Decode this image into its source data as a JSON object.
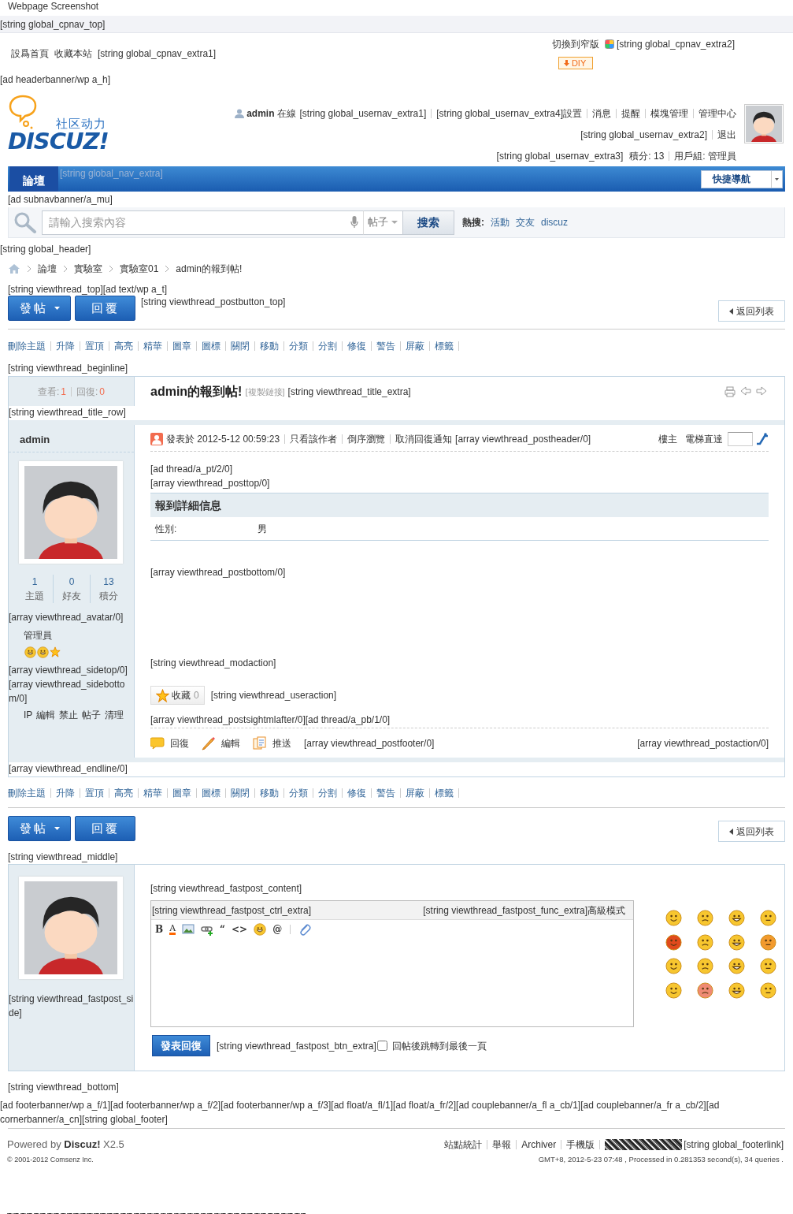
{
  "page_title": "Webpage Screenshot",
  "cpnav": {
    "top_text": "[string global_cpnav_top]",
    "links": [
      "設爲首頁",
      "收藏本站"
    ],
    "extra1": "[string global_cpnav_extra1]",
    "switch_width": "切換到窄版",
    "extra2": "[string global_cpnav_extra2]",
    "diy": "DIY"
  },
  "header_ad": "[ad headerbanner/wp a_h]",
  "logo": {
    "tagline": "社区动力",
    "wordmark": "DISCUZ!"
  },
  "usernav": {
    "username": "admin",
    "status": "在線",
    "extra1": "[string global_usernav_extra1]",
    "links": [
      "[string global_usernav_extra4]設置",
      "消息",
      "提醒",
      "模塊管理",
      "管理中心"
    ],
    "extra2": "[string global_usernav_extra2]",
    "logout": "退出",
    "extra3": "[string global_usernav_extra3]",
    "credits": "積分: 13",
    "group": "用戶組: 管理員"
  },
  "nav": {
    "items": [
      {
        "label": "論壇",
        "selected": true
      }
    ],
    "extra": "[string global_nav_extra]",
    "quick_nav": "快捷導航"
  },
  "subnav_ad": "[ad subnavbanner/a_mu]",
  "search": {
    "placeholder": "請輸入搜索內容",
    "scope": "帖子",
    "button": "搜索",
    "hot_label": "熱搜:",
    "hot": [
      "活動",
      "交友",
      "discuz"
    ]
  },
  "global_header": "[string global_header]",
  "breadcrumb": [
    "論壇",
    "實驗室",
    "實驗室01",
    "admin的報到帖!"
  ],
  "viewthread_top": "[string viewthread_top][ad text/wp a_t]",
  "post_bar_top": {
    "post": "發帖",
    "reply": "回覆",
    "extra": "[string viewthread_postbutton_top]",
    "back": "返回列表"
  },
  "mod_links_top": [
    "刪除主題",
    "升降",
    "置頂",
    "高亮",
    "精華",
    "圖章",
    "圖標",
    "關閉",
    "移動",
    "分類",
    "分割",
    "修復",
    "警告",
    "屏蔽",
    "標籤"
  ],
  "beginline": "[string viewthread_beginline]",
  "thread": {
    "views_label": "查看:",
    "views": "1",
    "replies_label": "回復:",
    "replies": "0",
    "title": "admin的報到帖!",
    "copy_link": "[複製鏈接]",
    "title_extra": "[string viewthread_title_extra]",
    "title_row": "[string viewthread_title_row]"
  },
  "post": {
    "author": "admin",
    "stats": [
      {
        "value": "1",
        "label": "主題"
      },
      {
        "value": "0",
        "label": "好友"
      },
      {
        "value": "13",
        "label": "積分"
      }
    ],
    "avatar_extra": "[array viewthread_avatar/0]",
    "group": "管理員",
    "side_extra": "[array viewthread_sidetop/0][array viewthread_sidebottom/0]",
    "admin_links": [
      "IP",
      "編輯",
      "禁止",
      "帖子",
      "清理"
    ],
    "posted": "發表於 2012-5-12 00:59:23",
    "header_links": [
      "只看該作者",
      "倒序瀏覽",
      "取消回復通知"
    ],
    "header_extra": "[array viewthread_postheader/0]",
    "floor": "樓主",
    "jump": "電梯直達",
    "ad_pt": "[ad thread/a_pt/2/0]",
    "posttop": "[array viewthread_posttop/0]",
    "info_title": "報到詳細信息",
    "fields": [
      {
        "label": "性別:",
        "value": "男"
      }
    ],
    "postbottom": "[array viewthread_postbottom/0]",
    "modaction": "[string viewthread_modaction]",
    "favorite": {
      "label": "收藏",
      "count": "0"
    },
    "useraction": "[string viewthread_useraction]",
    "sightml": "[array viewthread_postsightmlafter/0][ad thread/a_pb/1/0]",
    "actions": [
      {
        "kind": "reply",
        "label": "回復"
      },
      {
        "kind": "edit",
        "label": "編輯"
      },
      {
        "kind": "push",
        "label": "推送"
      }
    ],
    "postfooter": "[array viewthread_postfooter/0]",
    "postaction": "[array viewthread_postaction/0]"
  },
  "endline": "[array viewthread_endline/0]",
  "mod_links_bottom": [
    "刪除主題",
    "升降",
    "置頂",
    "高亮",
    "精華",
    "圖章",
    "圖標",
    "關閉",
    "移動",
    "分類",
    "分割",
    "修復",
    "警告",
    "屏蔽",
    "標籤"
  ],
  "post_bar_bottom": {
    "post": "發帖",
    "reply": "回覆",
    "back": "返回列表"
  },
  "middle": "[string viewthread_middle]",
  "fastpost": {
    "side": "[string viewthread_fastpost_side]",
    "content": "[string viewthread_fastpost_content]",
    "ctrl_extra": "[string viewthread_fastpost_ctrl_extra]",
    "func_extra": "[string viewthread_fastpost_func_extra]高級模式",
    "tools": [
      {
        "kind": "text",
        "label": "B"
      },
      {
        "kind": "color",
        "label": "A"
      },
      {
        "kind": "image"
      },
      {
        "kind": "link"
      },
      {
        "kind": "text",
        "label": "“"
      },
      {
        "kind": "text",
        "label": "<>"
      },
      {
        "kind": "emoji"
      },
      {
        "kind": "text",
        "label": "@"
      },
      {
        "kind": "attach"
      }
    ],
    "submit": "發表回復",
    "btn_extra": "[string viewthread_fastpost_btn_extra]",
    "jump_checked": false,
    "jump_label": "回帖後跳轉到最後一頁"
  },
  "bottom": "[string viewthread_bottom]",
  "footer_ads": "[ad footerbanner/wp a_f/1][ad footerbanner/wp a_f/2][ad footerbanner/wp a_f/3][ad float/a_fl/1][ad float/a_fr/2][ad couplebanner/a_fl a_cb/1][ad couplebanner/a_fr a_cb/2][ad cornerbanner/a_cn][string global_footer]",
  "footer": {
    "powered": "Powered by **Discuz!** X2.5",
    "copyright": "© 2001-2012 Comsenz Inc.",
    "links": [
      "站點統計",
      "舉報",
      "Archiver",
      "手機版"
    ],
    "footerlink": "[string global_footerlink]",
    "stats": "GMT+8, 2012-5-23 07:48 , Processed in 0.281353 second(s), 34 queries ."
  }
}
